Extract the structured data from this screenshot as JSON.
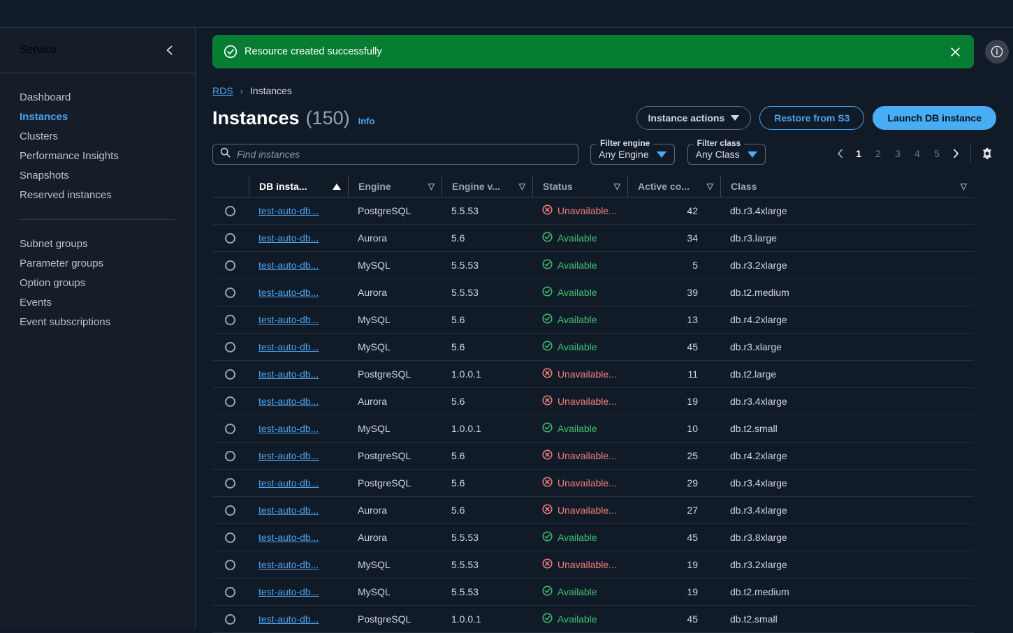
{
  "sidebar": {
    "title": "Service",
    "collapse_icon": "chevron-left-icon",
    "items": [
      {
        "label": "Dashboard",
        "active": false
      },
      {
        "label": "Instances",
        "active": true
      },
      {
        "label": "Clusters",
        "active": false
      },
      {
        "label": "Performance Insights",
        "active": false
      },
      {
        "label": "Snapshots",
        "active": false
      },
      {
        "label": "Reserved instances",
        "active": false
      }
    ],
    "items2": [
      {
        "label": "Subnet groups"
      },
      {
        "label": "Parameter groups"
      },
      {
        "label": "Option groups"
      },
      {
        "label": "Events"
      },
      {
        "label": "Event subscriptions"
      }
    ]
  },
  "banner": {
    "message": "Resource created successfully",
    "icon": "check-circle-icon",
    "close_icon": "close-icon",
    "color": "#067d33"
  },
  "info_fab": {
    "icon": "info-circle-icon"
  },
  "breadcrumb": {
    "root": "RDS",
    "separator": "›",
    "current": "Instances"
  },
  "header": {
    "title": "Instances",
    "count": "(150)",
    "info_label": "Info",
    "actions": {
      "instance_actions": "Instance actions",
      "restore_from_s3": "Restore from S3",
      "launch_db_instance": "Launch DB instance"
    }
  },
  "search": {
    "placeholder": "Find instances",
    "value": "",
    "icon": "search-icon"
  },
  "filters": [
    {
      "legend": "Filter engine",
      "value": "Any Engine"
    },
    {
      "legend": "Filter class",
      "value": "Any Class"
    }
  ],
  "pagination": {
    "prev_icon": "chevron-left-icon",
    "next_icon": "chevron-right-icon",
    "pages": [
      "1",
      "2",
      "3",
      "4",
      "5"
    ],
    "active_page": "1",
    "settings_icon": "gear-icon"
  },
  "table": {
    "columns": [
      {
        "label": "DB insta...",
        "sort": "asc"
      },
      {
        "label": "Engine",
        "sort": "none"
      },
      {
        "label": "Engine v...",
        "sort": "none"
      },
      {
        "label": "Status",
        "sort": "none"
      },
      {
        "label": "Active co...",
        "sort": "none"
      },
      {
        "label": "Class",
        "sort": "none"
      }
    ],
    "rows": [
      {
        "name": "test-auto-db...",
        "engine": "PostgreSQL",
        "version": "5.5.53",
        "status": "Unavailable...",
        "status_type": "unavailable",
        "active": "42",
        "class": "db.r3.4xlarge"
      },
      {
        "name": "test-auto-db...",
        "engine": "Aurora",
        "version": "5.6",
        "status": "Available",
        "status_type": "available",
        "active": "34",
        "class": "db.r3.large"
      },
      {
        "name": "test-auto-db...",
        "engine": "MySQL",
        "version": "5.5.53",
        "status": "Available",
        "status_type": "available",
        "active": "5",
        "class": "db.r3.2xlarge"
      },
      {
        "name": "test-auto-db...",
        "engine": "Aurora",
        "version": "5.5.53",
        "status": "Available",
        "status_type": "available",
        "active": "39",
        "class": "db.t2.medium"
      },
      {
        "name": "test-auto-db...",
        "engine": "MySQL",
        "version": "5.6",
        "status": "Available",
        "status_type": "available",
        "active": "13",
        "class": "db.r4.2xlarge"
      },
      {
        "name": "test-auto-db...",
        "engine": "MySQL",
        "version": "5.6",
        "status": "Available",
        "status_type": "available",
        "active": "45",
        "class": "db.r3.xlarge"
      },
      {
        "name": "test-auto-db...",
        "engine": "PostgreSQL",
        "version": "1.0.0.1",
        "status": "Unavailable...",
        "status_type": "unavailable",
        "active": "11",
        "class": "db.t2.large"
      },
      {
        "name": "test-auto-db...",
        "engine": "Aurora",
        "version": "5.6",
        "status": "Unavailable...",
        "status_type": "unavailable",
        "active": "19",
        "class": "db.r3.4xlarge"
      },
      {
        "name": "test-auto-db...",
        "engine": "MySQL",
        "version": "1.0.0.1",
        "status": "Available",
        "status_type": "available",
        "active": "10",
        "class": "db.t2.small"
      },
      {
        "name": "test-auto-db...",
        "engine": "PostgreSQL",
        "version": "5.6",
        "status": "Unavailable...",
        "status_type": "unavailable",
        "active": "25",
        "class": "db.r4.2xlarge"
      },
      {
        "name": "test-auto-db...",
        "engine": "PostgreSQL",
        "version": "5.6",
        "status": "Unavailable...",
        "status_type": "unavailable",
        "active": "29",
        "class": "db.r3.4xlarge"
      },
      {
        "name": "test-auto-db...",
        "engine": "Aurora",
        "version": "5.6",
        "status": "Unavailable...",
        "status_type": "unavailable",
        "active": "27",
        "class": "db.r3.4xlarge"
      },
      {
        "name": "test-auto-db...",
        "engine": "Aurora",
        "version": "5.5.53",
        "status": "Available",
        "status_type": "available",
        "active": "45",
        "class": "db.r3.8xlarge"
      },
      {
        "name": "test-auto-db...",
        "engine": "MySQL",
        "version": "5.5.53",
        "status": "Unavailable...",
        "status_type": "unavailable",
        "active": "19",
        "class": "db.r3.2xlarge"
      },
      {
        "name": "test-auto-db...",
        "engine": "MySQL",
        "version": "5.5.53",
        "status": "Available",
        "status_type": "available",
        "active": "19",
        "class": "db.t2.medium"
      },
      {
        "name": "test-auto-db...",
        "engine": "PostgreSQL",
        "version": "1.0.0.1",
        "status": "Available",
        "status_type": "available",
        "active": "45",
        "class": "db.t2.small"
      }
    ]
  },
  "colors": {
    "accent": "#4aa3f0",
    "primary_button": "#49adf5",
    "success": "#067d33",
    "status_available": "#3ec16f",
    "status_unavailable": "#f2807c",
    "background": "#111b28",
    "sidebar_bg": "#161d29"
  }
}
